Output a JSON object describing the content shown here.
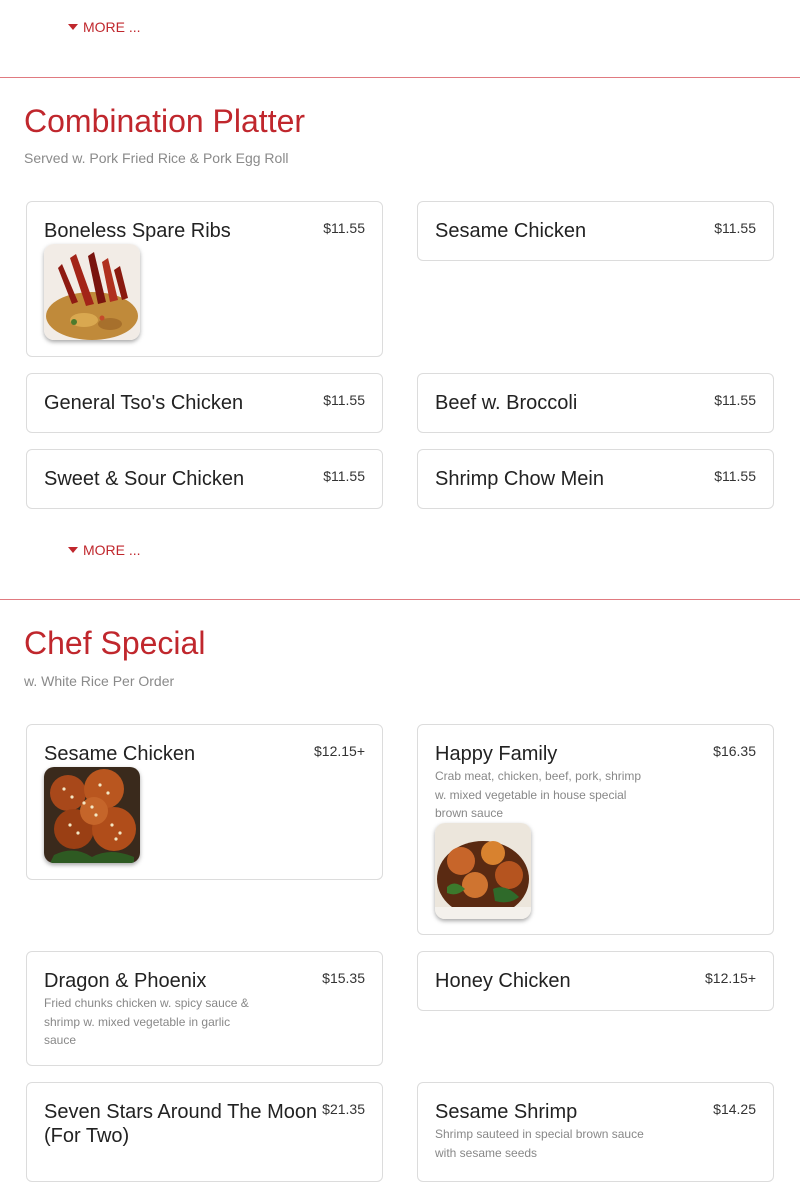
{
  "sections": [
    {
      "more_label": "MORE ..."
    },
    {
      "title": "Combination Platter",
      "subtitle": "Served w. Pork Fried Rice & Pork Egg Roll",
      "more_label": "MORE ...",
      "items": [
        {
          "name": "Boneless Spare Ribs",
          "price": "$11.55",
          "image": "boneless-spare-ribs-photo"
        },
        {
          "name": "Sesame Chicken",
          "price": "$11.55"
        },
        {
          "name": "General Tso's Chicken",
          "price": "$11.55"
        },
        {
          "name": "Beef w. Broccoli",
          "price": "$11.55"
        },
        {
          "name": "Sweet & Sour Chicken",
          "price": "$11.55"
        },
        {
          "name": "Shrimp Chow Mein",
          "price": "$11.55"
        }
      ]
    },
    {
      "title": "Chef Special",
      "subtitle": "w. White Rice Per Order",
      "items": [
        {
          "name": "Sesame Chicken",
          "price": "$12.15+",
          "image": "sesame-chicken-photo"
        },
        {
          "name": "Happy Family",
          "price": "$16.35",
          "description": "Crab meat, chicken, beef, pork, shrimp w. mixed vegetable in house special brown sauce",
          "image": "happy-family-photo"
        },
        {
          "name": "Dragon & Phoenix",
          "price": "$15.35",
          "description": "Fried chunks chicken w. spicy sauce & shrimp w. mixed vegetable in garlic sauce"
        },
        {
          "name": "Honey Chicken",
          "price": "$12.15+"
        },
        {
          "name": "Seven Stars Around The Moon (For Two)",
          "price": "$21.35"
        },
        {
          "name": "Sesame Shrimp",
          "price": "$14.25",
          "description": "Shrimp sauteed in special brown sauce with sesame seeds"
        }
      ]
    }
  ],
  "colors": {
    "accent": "#c0272d",
    "divider": "#e07a80",
    "border": "#dcdcdc"
  },
  "icons": {
    "more": "caret-down-icon"
  }
}
